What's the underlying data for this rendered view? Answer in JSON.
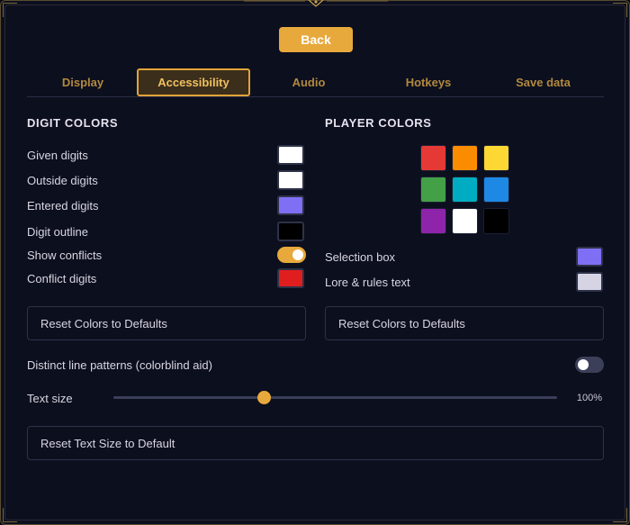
{
  "back_label": "Back",
  "tabs": [
    {
      "label": "Display"
    },
    {
      "label": "Accessibility"
    },
    {
      "label": "Audio"
    },
    {
      "label": "Hotkeys"
    },
    {
      "label": "Save data"
    }
  ],
  "active_tab": "Accessibility",
  "digit_colors": {
    "title": "DIGIT COLORS",
    "rows": [
      {
        "label": "Given digits",
        "color": "#ffffff"
      },
      {
        "label": "Outside digits",
        "color": "#ffffff"
      },
      {
        "label": "Entered digits",
        "color": "#7f6ff4"
      },
      {
        "label": "Digit outline",
        "color": "#000000"
      },
      {
        "label": "Show conflicts",
        "toggle": true
      },
      {
        "label": "Conflict digits",
        "color": "#e01e1e"
      }
    ],
    "reset_label": "Reset Colors to Defaults"
  },
  "player_colors": {
    "title": "PLAYER COLORS",
    "palette": [
      "#e53935",
      "#fb8c00",
      "#fdd835",
      "#43a047",
      "#00acc1",
      "#1e88e5",
      "#8e24aa",
      "#ffffff",
      "#000000"
    ],
    "rows": [
      {
        "label": "Selection box",
        "color": "#7f6ff4"
      },
      {
        "label": "Lore & rules text",
        "color": "#d6d4e4"
      }
    ],
    "reset_label": "Reset Colors to Defaults"
  },
  "line_patterns": {
    "label": "Distinct line patterns (colorblind aid)",
    "enabled": false
  },
  "text_size": {
    "label": "Text size",
    "value_label": "100%",
    "level": 0.34
  },
  "reset_text_size_label": "Reset Text Size to Default",
  "colors": {
    "accent": "#e8a93c",
    "panel": "#0c0f1e",
    "tab_text": "#b2893e"
  }
}
